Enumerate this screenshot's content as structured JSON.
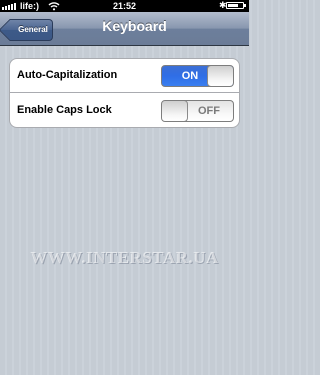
{
  "status_bar": {
    "carrier": "life:)",
    "time": "21:52",
    "battery_level": 0.7,
    "bluetooth_icon": "bluetooth-icon",
    "wifi_icon": "wifi-icon",
    "signal_icon": "signal-bars-icon"
  },
  "nav": {
    "back_label": "General",
    "title": "Keyboard"
  },
  "settings": [
    {
      "label": "Auto-Capitalization",
      "state": "ON",
      "enabled": true
    },
    {
      "label": "Enable Caps Lock",
      "state": "OFF",
      "enabled": false
    }
  ],
  "watermark": "WWW.INTERSTAR.UA",
  "colors": {
    "nav_bar": "#7e8fab",
    "toggle_on": "#2f6ee6",
    "background": "#c5ccd4"
  }
}
